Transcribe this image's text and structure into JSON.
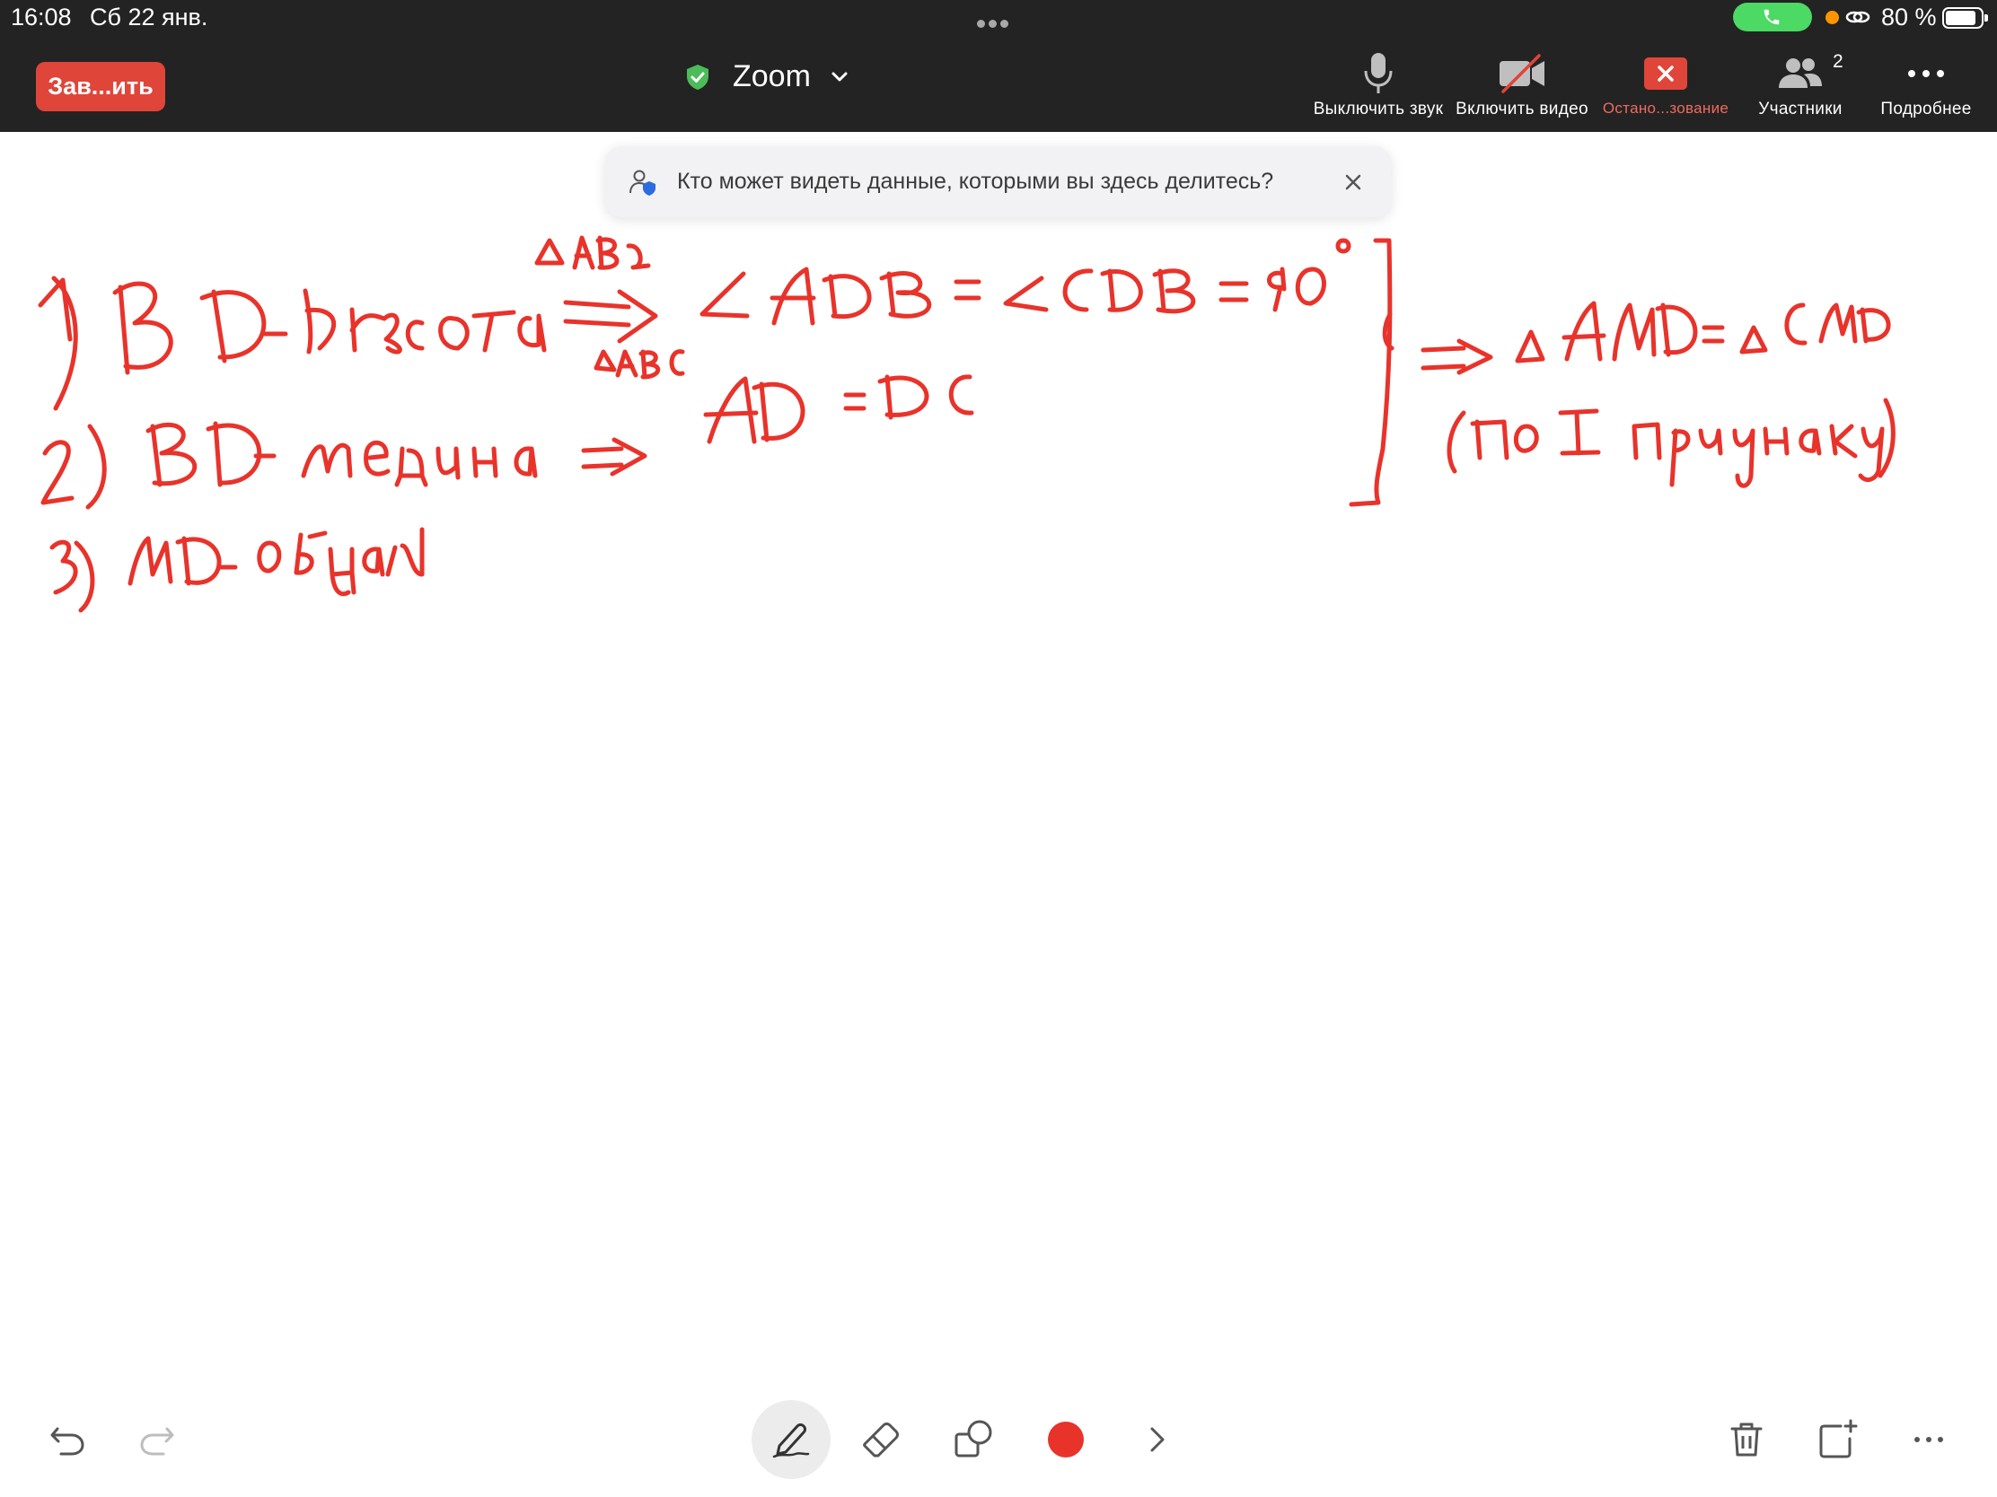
{
  "status_bar": {
    "time": "16:08",
    "date": "Сб 22 янв.",
    "battery": "80 %",
    "call_color": "#4cd964",
    "indicator_color": "#ff9500"
  },
  "toolbar": {
    "end_button": "Зав...ить",
    "end_color": "#e0453a",
    "title": "Zoom",
    "items": [
      {
        "label": "Выключить звук",
        "icon": "microphone-icon"
      },
      {
        "label": "Включить видео",
        "icon": "video-off-icon"
      },
      {
        "label": "Остано...зование",
        "icon": "stop-share-icon"
      },
      {
        "label": "Участники",
        "icon": "participants-icon",
        "badge": "2"
      },
      {
        "label": "Подробнее",
        "icon": "more-icon"
      }
    ]
  },
  "notice": {
    "text": "Кто может видеть данные, которыми вы здесь делитесь?",
    "icon": "privacy-shield-icon"
  },
  "whiteboard": {
    "ink_color": "#e8332b",
    "lines": [
      "1) BD - высота ⇒ ∠ADB = ∠CDB = 90°",
      "ΔABC",
      "2) BD - медиана ⇒ AD = DC",
      "ΔABC",
      "3) MD - общая",
      "⇒ ΔAMD = ΔCMD",
      "(по I признаку)"
    ]
  },
  "bottom_toolbar": {
    "tools": [
      "undo-icon",
      "redo-icon",
      "pen-icon",
      "eraser-icon",
      "shapes-icon",
      "color-swatch",
      "expand-chevron-icon",
      "trash-icon",
      "new-page-icon",
      "more-icon"
    ],
    "selected_color": "#e8332b"
  }
}
